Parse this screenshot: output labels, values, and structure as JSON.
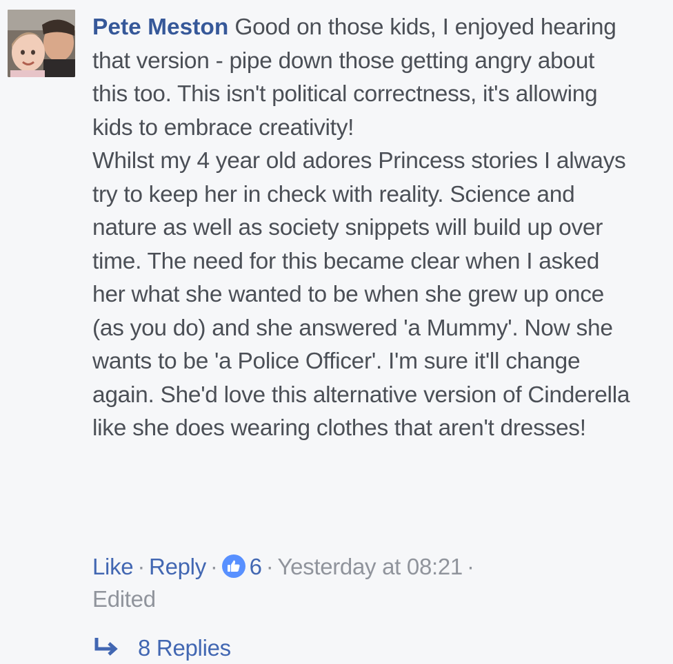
{
  "comment": {
    "author": "Pete Meston",
    "text_first": " Good on those kids, I enjoyed hearing that version - pipe down those getting angry about this too. This isn't political correctness, it's allowing kids to embrace creativity!",
    "text_second": "Whilst my 4 year old adores Princess stories I always try to keep her in check with reality. Science and nature as well as society snippets will build up over time. The need for this became clear when I asked her what she wanted to be when she grew up once (as you do) and she answered 'a Mummy'. Now she wants to be 'a Police Officer'. I'm sure it'll change again. She'd love this alternative version of Cinderella like she does wearing clothes that aren't dresses!",
    "actions": {
      "like_label": "Like",
      "reply_label": "Reply",
      "separator": "·",
      "like_count": "6",
      "timestamp": "Yesterday at 08:21",
      "edited_label": "Edited"
    },
    "replies_label": "8 Replies"
  },
  "colors": {
    "background": "#f6f7f9",
    "author": "#365899",
    "link": "#4267b2",
    "body_text": "#4b4f56",
    "meta_text": "#90949c",
    "like_badge": "#5890ff"
  },
  "icons": {
    "like_badge": "thumbs-up-icon",
    "replies": "reply-arrow-icon"
  }
}
